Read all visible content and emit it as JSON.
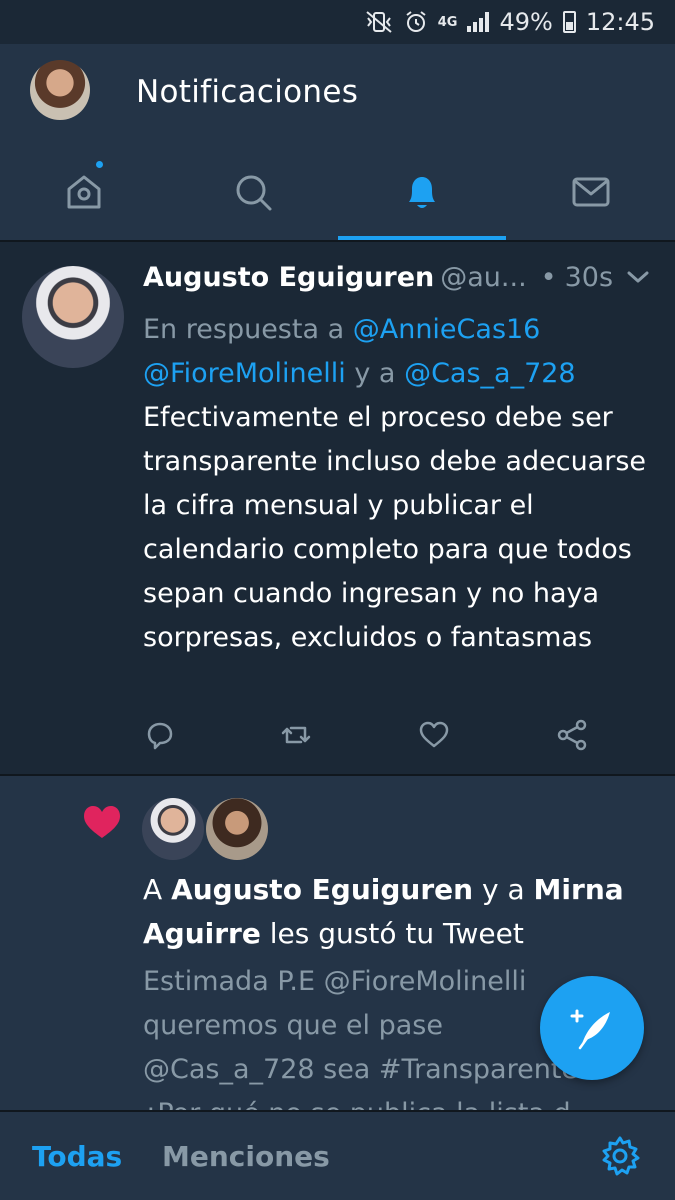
{
  "status_bar": {
    "battery": "49%",
    "time": "12:45",
    "network": "4G"
  },
  "header": {
    "title": "Notificaciones"
  },
  "tabs": [
    {
      "name": "home-icon",
      "active": false,
      "has_dot": true
    },
    {
      "name": "search-icon",
      "active": false
    },
    {
      "name": "bell-icon",
      "active": true
    },
    {
      "name": "mail-icon",
      "active": false
    }
  ],
  "tweet": {
    "author_name": "Augusto Eguiguren",
    "handle": "@au...",
    "separator": "•",
    "time": "30s",
    "reply_prefix": "En respuesta a",
    "reply_mention_1": "@AnnieCas16",
    "reply_mention_2": "@FioreMolinelli",
    "reply_and": "y a",
    "reply_mention_3": "@Cas_a_728",
    "text": "Efectivamente el proceso debe ser transparente incluso debe adecuarse la cifra mensual y publicar el calendario completo para que todos sepan cuando ingresan y no haya sorpresas, excluidos o fantasmas"
  },
  "like_notification": {
    "prefix": "A",
    "user_1": "Augusto Eguiguren",
    "connector": "y a",
    "user_2": "Mirna Aguirre",
    "suffix": "les gustó tu Tweet",
    "preview_line_1": "Estimada P.E @FioreMolinelli",
    "preview_line_2": "queremos que el pase",
    "preview_line_3": "@Cas_a_728 sea #Transparente",
    "preview_line_4": "¿Por qué no se publica la lista d"
  },
  "bottom_bar": {
    "filter_all": "Todas",
    "filter_mentions": "Menciones"
  },
  "colors": {
    "accent": "#1da1f2",
    "like": "#e0245e",
    "background": "#1b2836",
    "header": "#243447",
    "muted": "#8899a6"
  }
}
